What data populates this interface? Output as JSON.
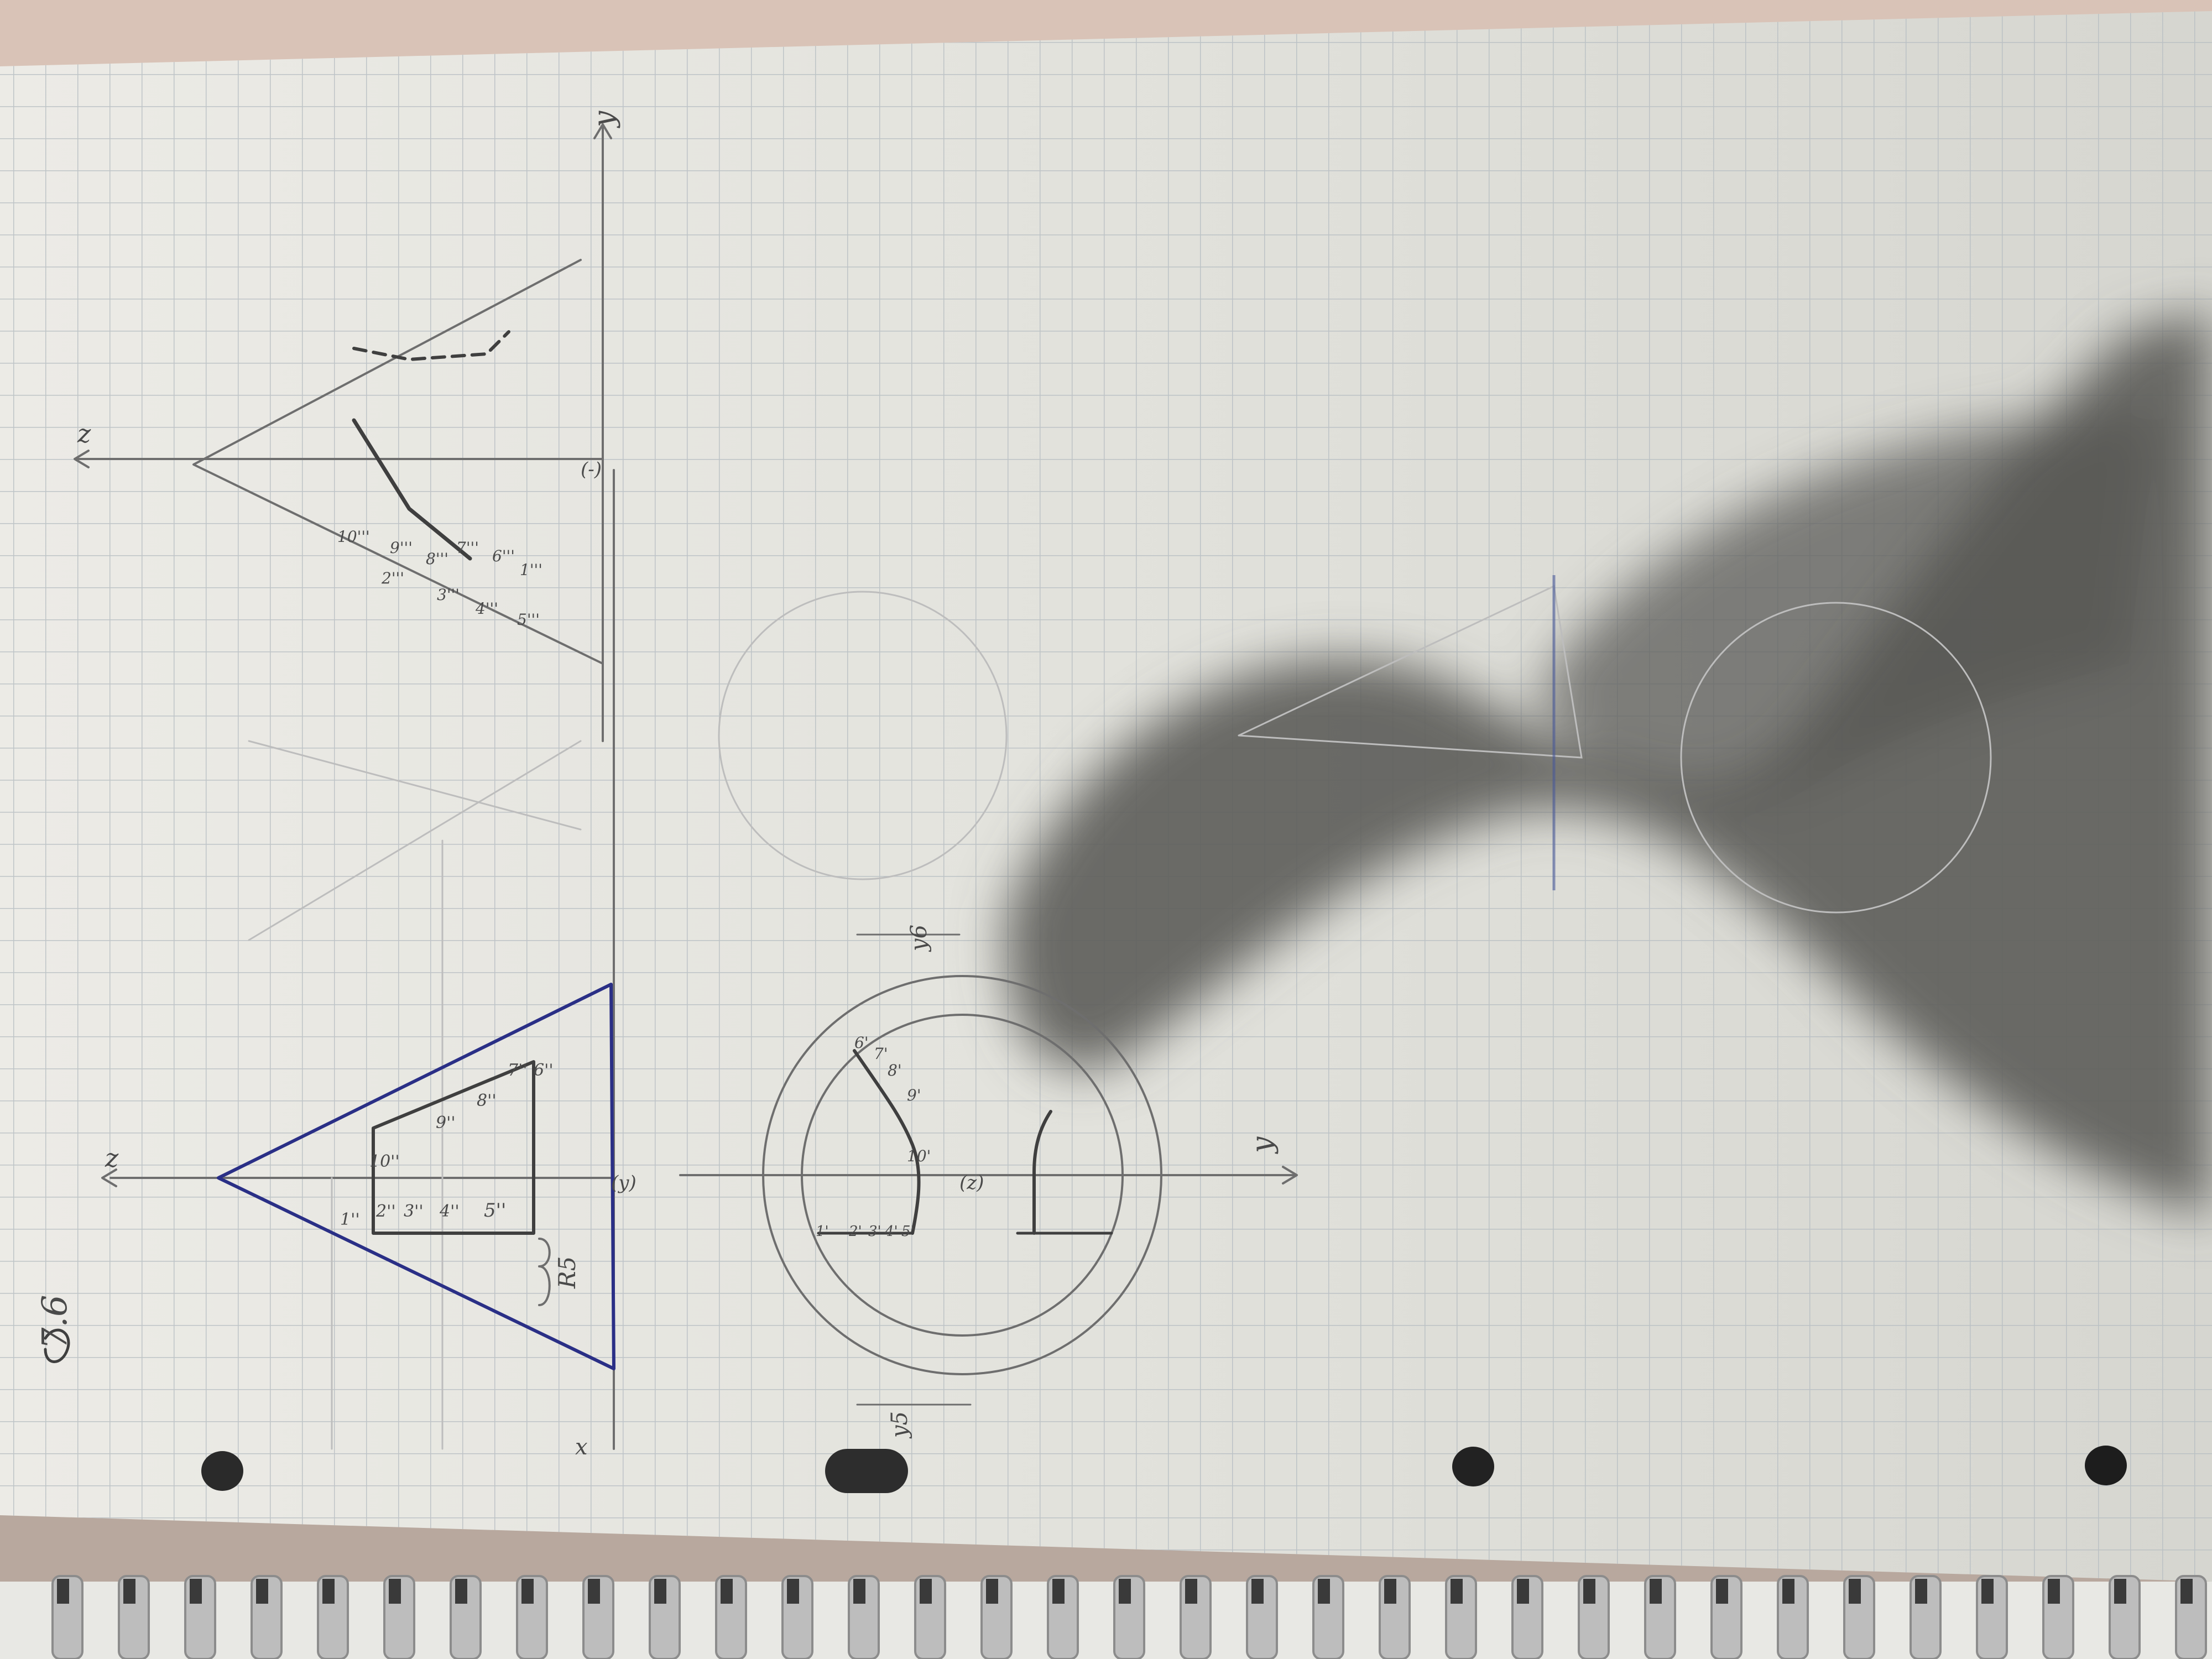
{
  "problem_number": "7.6",
  "axes": {
    "z": "z",
    "y": "y",
    "x": "x",
    "x_origin": "(-)",
    "y_origin": "(y)",
    "z_origin": "(z)"
  },
  "front_view_labels": [
    "1''",
    "2''",
    "3''",
    "4''",
    "5''",
    "6''",
    "7''",
    "8''",
    "9''",
    "10''"
  ],
  "radius_label": "R5",
  "profile_view_labels": [
    "10'''",
    "9'''",
    "2'''",
    "8'''",
    "3'''",
    "7'''",
    "4'''",
    "6'''",
    "5'''",
    "1'''"
  ],
  "top_view_labels": [
    "10'",
    "8'",
    "9'",
    "7'",
    "6'",
    "5'",
    "4'",
    "3'",
    "2'",
    "1'"
  ],
  "dimension_labels": [
    "y6",
    "y5",
    "y6"
  ],
  "colors": {
    "paper": "#e4e4de",
    "grid": "#b9c0c4",
    "pencil": "#6e6e6e",
    "ink": "#2a2f86",
    "shadow": "#5d5d5a",
    "spiral": "#c9c9c9"
  }
}
